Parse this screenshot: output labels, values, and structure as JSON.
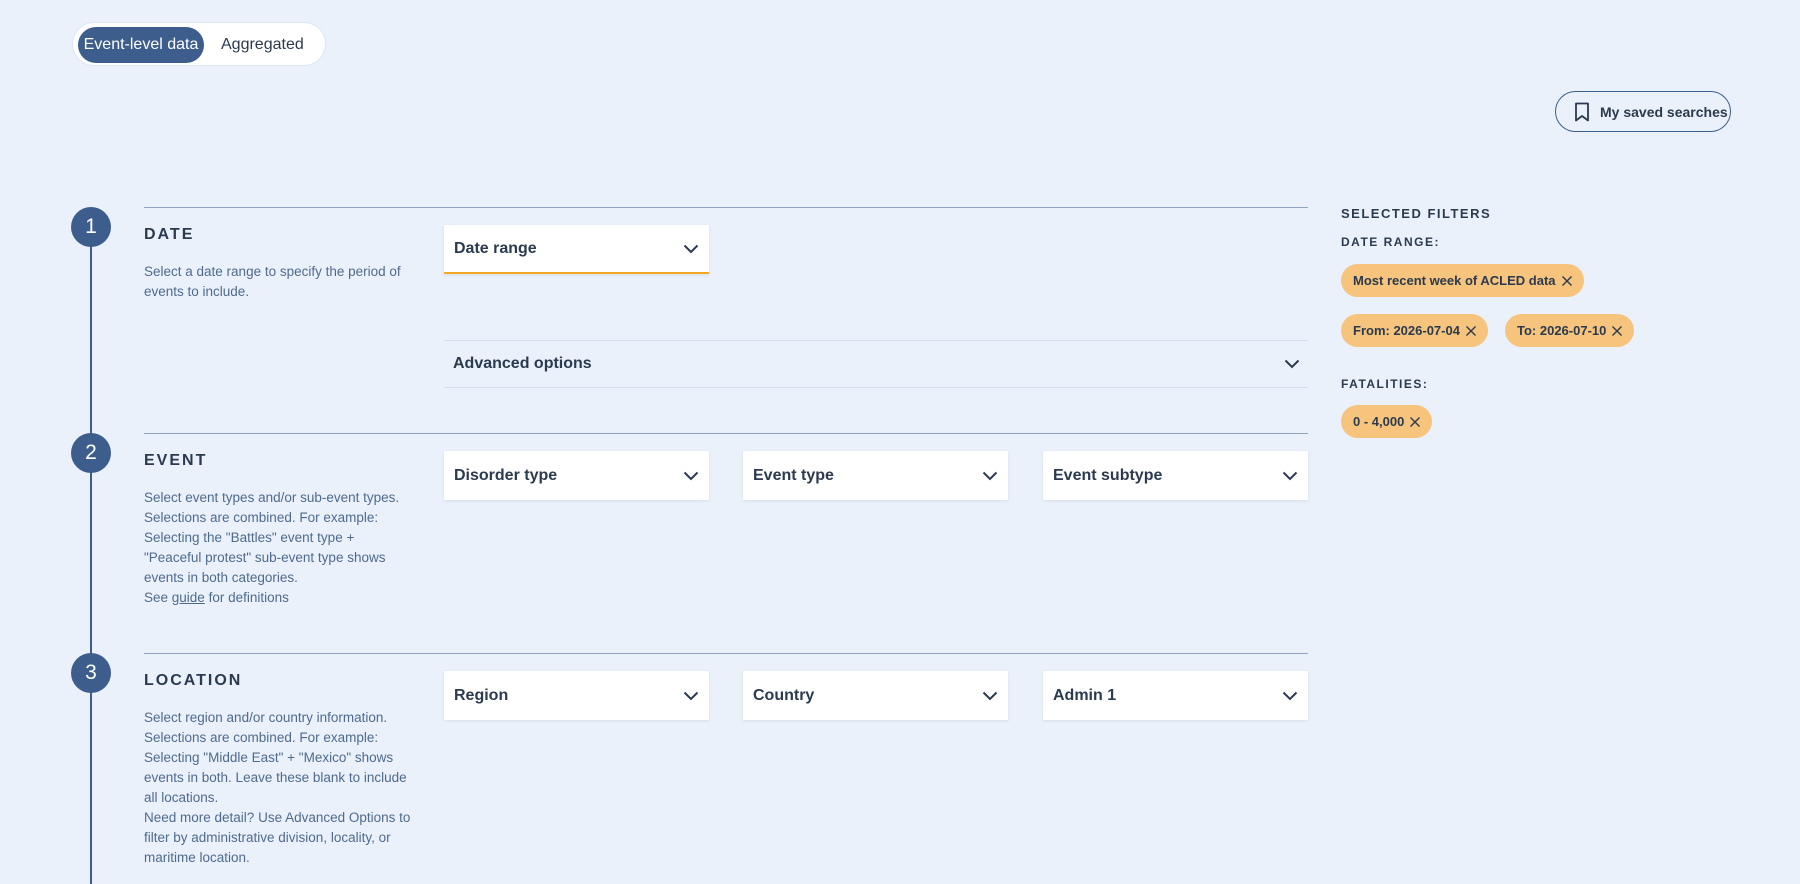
{
  "toggle": {
    "active": "Event-level data",
    "inactive": "Aggregated"
  },
  "saved_searches": {
    "label": "My saved searches",
    "icon": "bookmark-icon"
  },
  "sections": {
    "date": {
      "number": "1",
      "title": "DATE",
      "description": "Select a date range to specify the period of events to include.",
      "dropdown": "Date range",
      "advanced_options": "Advanced options"
    },
    "event": {
      "number": "2",
      "title": "EVENT",
      "description": "Select event types and/or sub-event types. Selections are combined. For example: Selecting the \"Battles\" event type + \"Peaceful protest\" sub-event type shows events in both categories.",
      "see_prefix": "See ",
      "guide_link": "guide",
      "see_suffix": " for definitions",
      "dropdowns": [
        "Disorder type",
        "Event type",
        "Event subtype"
      ]
    },
    "location": {
      "number": "3",
      "title": "LOCATION",
      "description": "Select region and/or country information. Selections are combined. For example: Selecting \"Middle East\" + \"Mexico\" shows events in both. Leave these blank to include all locations.",
      "description_2": "Need more detail? Use Advanced Options to filter by administrative division, locality, or maritime location.",
      "dropdowns": [
        "Region",
        "Country",
        "Admin 1"
      ]
    }
  },
  "selected_filters": {
    "title": "SELECTED FILTERS",
    "date_range_label": "DATE RANGE:",
    "date_range_chips": [
      "Most recent week of ACLED data",
      "From: 2026-07-04",
      "To: 2026-07-10"
    ],
    "fatalities_label": "FATALITIES:",
    "fatalities_chips": [
      "0 - 4,000"
    ]
  },
  "colors": {
    "background": "#eaf1fa",
    "accent": "#3d5d8c",
    "chip": "#f6c47c",
    "highlight": "#f5a623"
  }
}
